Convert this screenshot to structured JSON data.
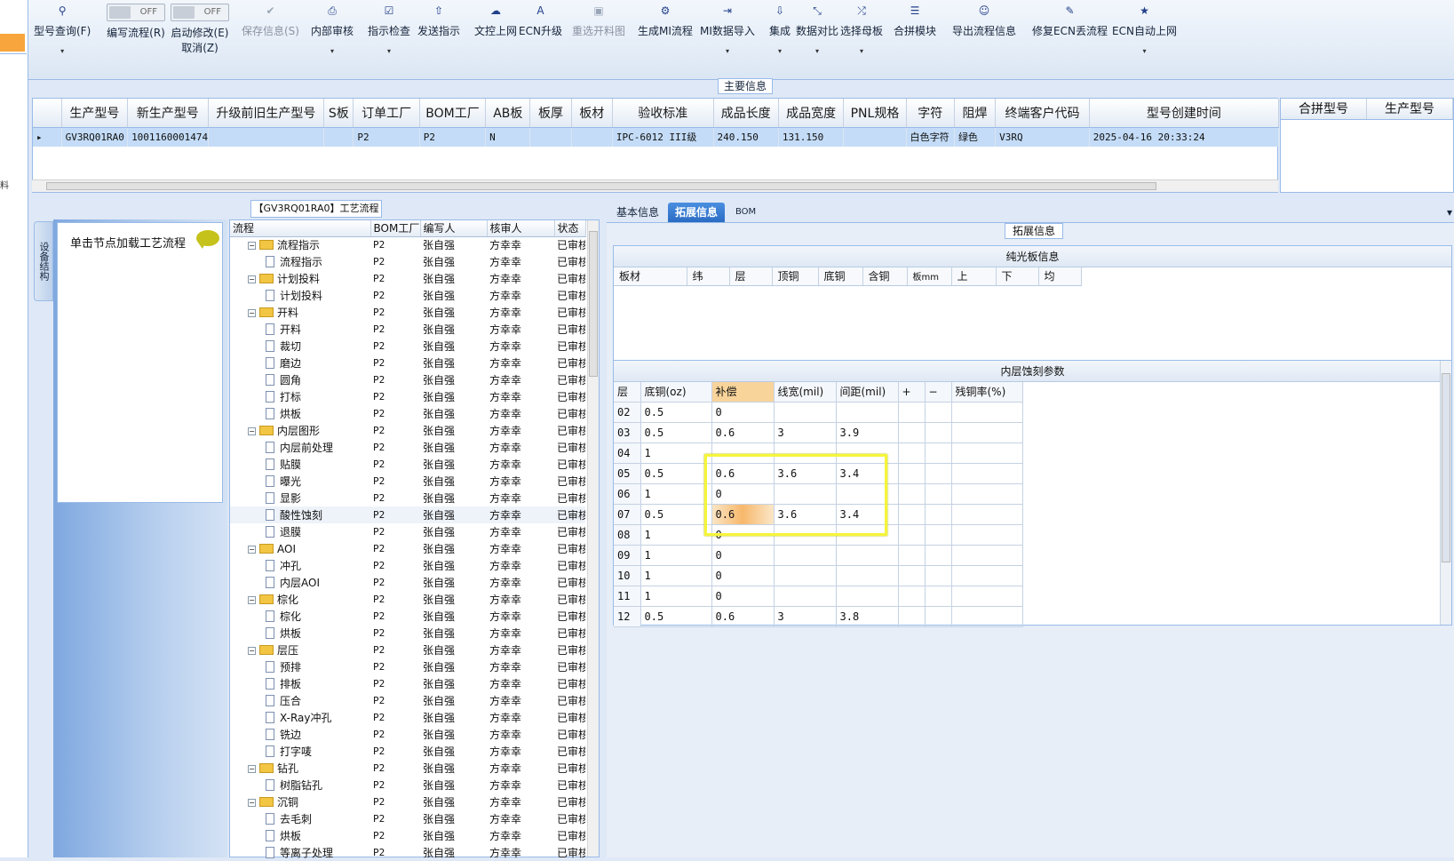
{
  "left_strip": {
    "label": "料"
  },
  "toolbar": {
    "items": [
      {
        "label": "型号查询(F)",
        "icon": "search-icon",
        "glyph": "⚲",
        "dropdown": true,
        "disabled": false
      },
      {
        "label": "编写流程(R)",
        "toggle": "OFF"
      },
      {
        "label": "启动修改(E)",
        "label2": "取消(Z)",
        "toggle": "OFF"
      },
      {
        "label": "保存信息(S)",
        "icon": "check-icon",
        "glyph": "✔",
        "disabled": true
      },
      {
        "label": "内部审核",
        "icon": "print-icon",
        "glyph": "⎙",
        "dropdown": true
      },
      {
        "label": "指示检查",
        "icon": "checkbox-icon",
        "glyph": "☑",
        "dropdown": true
      },
      {
        "label": "发送指示",
        "icon": "upload-icon",
        "glyph": "⇧"
      },
      {
        "label": "文控上网",
        "icon": "cloud-upload-icon",
        "glyph": "☁"
      },
      {
        "label": "ECN升级",
        "icon": "font-icon",
        "glyph": "A"
      },
      {
        "label": "重选开料图",
        "icon": "image-icon",
        "glyph": "▣",
        "disabled": true
      },
      {
        "label": "生成MI流程",
        "icon": "gears-icon",
        "glyph": "⚙"
      },
      {
        "label": "MI数据导入",
        "icon": "import-icon",
        "glyph": "⇥",
        "dropdown": true
      },
      {
        "label": "集成",
        "icon": "download-icon",
        "glyph": "⇩",
        "dropdown": true
      },
      {
        "label": "数据对比",
        "icon": "compress-icon",
        "glyph": "⤡",
        "dropdown": true
      },
      {
        "label": "选择母板",
        "icon": "shuffle-icon",
        "glyph": "⤮",
        "dropdown": true
      },
      {
        "label": "合拼模块",
        "icon": "list-icon",
        "glyph": "☰"
      },
      {
        "label": "导出流程信息",
        "icon": "smile-icon",
        "glyph": "☺"
      },
      {
        "label": "修复ECN丢流程",
        "icon": "wrench-icon",
        "glyph": "✎"
      },
      {
        "label": "ECN自动上网",
        "icon": "star-icon",
        "glyph": "★",
        "dropdown": true
      }
    ]
  },
  "main_info": {
    "title": "主要信息",
    "columns": [
      "生产型号",
      "新生产型号",
      "升级前旧生产型号",
      "S板",
      "订单工厂",
      "BOM工厂",
      "AB板",
      "板厚",
      "板材",
      "验收标准",
      "成品长度",
      "成品宽度",
      "PNL规格",
      "字符",
      "阻焊",
      "终端客户代码",
      "型号创建时间"
    ],
    "row": [
      "GV3RQ01RA0",
      "10011600014747",
      "",
      "",
      "P2",
      "P2",
      "N",
      "",
      "",
      "IPC-6012 III级",
      "240.150",
      "131.150",
      "",
      "白色字符",
      "绿色",
      "V3RQ",
      "2025-04-16 20:33:24"
    ],
    "side_columns": [
      "合拼型号",
      "生产型号"
    ]
  },
  "flow": {
    "title": "【GV3RQ01RA0】工艺流程",
    "side_tab": "设备结构",
    "load_hint": "单击节点加载工艺流程",
    "columns": [
      "流程",
      "BOM工厂",
      "编写人",
      "核审人",
      "状态"
    ],
    "rows": [
      {
        "name": "流程指示",
        "level": 0,
        "factory": "P2",
        "writer": "张自强",
        "reviewer": "方幸幸",
        "status": "已审核"
      },
      {
        "name": "流程指示",
        "level": 1,
        "factory": "P2",
        "writer": "张自强",
        "reviewer": "方幸幸",
        "status": "已审核"
      },
      {
        "name": "计划投料",
        "level": 0,
        "factory": "P2",
        "writer": "张自强",
        "reviewer": "方幸幸",
        "status": "已审核"
      },
      {
        "name": "计划投料",
        "level": 1,
        "factory": "P2",
        "writer": "张自强",
        "reviewer": "方幸幸",
        "status": "已审核"
      },
      {
        "name": "开料",
        "level": 0,
        "factory": "P2",
        "writer": "张自强",
        "reviewer": "方幸幸",
        "status": "已审核"
      },
      {
        "name": "开料",
        "level": 1,
        "factory": "P2",
        "writer": "张自强",
        "reviewer": "方幸幸",
        "status": "已审核"
      },
      {
        "name": "裁切",
        "level": 1,
        "factory": "P2",
        "writer": "张自强",
        "reviewer": "方幸幸",
        "status": "已审核"
      },
      {
        "name": "磨边",
        "level": 1,
        "factory": "P2",
        "writer": "张自强",
        "reviewer": "方幸幸",
        "status": "已审核"
      },
      {
        "name": "圆角",
        "level": 1,
        "factory": "P2",
        "writer": "张自强",
        "reviewer": "方幸幸",
        "status": "已审核"
      },
      {
        "name": "打标",
        "level": 1,
        "factory": "P2",
        "writer": "张自强",
        "reviewer": "方幸幸",
        "status": "已审核"
      },
      {
        "name": "烘板",
        "level": 1,
        "factory": "P2",
        "writer": "张自强",
        "reviewer": "方幸幸",
        "status": "已审核"
      },
      {
        "name": "内层图形",
        "level": 0,
        "factory": "P2",
        "writer": "张自强",
        "reviewer": "方幸幸",
        "status": "已审核"
      },
      {
        "name": "内层前处理",
        "level": 1,
        "factory": "P2",
        "writer": "张自强",
        "reviewer": "方幸幸",
        "status": "已审核"
      },
      {
        "name": "贴膜",
        "level": 1,
        "factory": "P2",
        "writer": "张自强",
        "reviewer": "方幸幸",
        "status": "已审核"
      },
      {
        "name": "曝光",
        "level": 1,
        "factory": "P2",
        "writer": "张自强",
        "reviewer": "方幸幸",
        "status": "已审核"
      },
      {
        "name": "显影",
        "level": 1,
        "factory": "P2",
        "writer": "张自强",
        "reviewer": "方幸幸",
        "status": "已审核"
      },
      {
        "name": "酸性蚀刻",
        "level": 1,
        "factory": "P2",
        "writer": "张自强",
        "reviewer": "方幸幸",
        "status": "已审核",
        "selected": true
      },
      {
        "name": "退膜",
        "level": 1,
        "factory": "P2",
        "writer": "张自强",
        "reviewer": "方幸幸",
        "status": "已审核"
      },
      {
        "name": "AOI",
        "level": 0,
        "factory": "P2",
        "writer": "张自强",
        "reviewer": "方幸幸",
        "status": "已审核"
      },
      {
        "name": "冲孔",
        "level": 1,
        "factory": "P2",
        "writer": "张自强",
        "reviewer": "方幸幸",
        "status": "已审核"
      },
      {
        "name": "内层AOI",
        "level": 1,
        "factory": "P2",
        "writer": "张自强",
        "reviewer": "方幸幸",
        "status": "已审核"
      },
      {
        "name": "棕化",
        "level": 0,
        "factory": "P2",
        "writer": "张自强",
        "reviewer": "方幸幸",
        "status": "已审核"
      },
      {
        "name": "棕化",
        "level": 1,
        "factory": "P2",
        "writer": "张自强",
        "reviewer": "方幸幸",
        "status": "已审核"
      },
      {
        "name": "烘板",
        "level": 1,
        "factory": "P2",
        "writer": "张自强",
        "reviewer": "方幸幸",
        "status": "已审核"
      },
      {
        "name": "层压",
        "level": 0,
        "factory": "P2",
        "writer": "张自强",
        "reviewer": "方幸幸",
        "status": "已审核"
      },
      {
        "name": "预排",
        "level": 1,
        "factory": "P2",
        "writer": "张自强",
        "reviewer": "方幸幸",
        "status": "已审核"
      },
      {
        "name": "排板",
        "level": 1,
        "factory": "P2",
        "writer": "张自强",
        "reviewer": "方幸幸",
        "status": "已审核"
      },
      {
        "name": "压合",
        "level": 1,
        "factory": "P2",
        "writer": "张自强",
        "reviewer": "方幸幸",
        "status": "已审核"
      },
      {
        "name": "X-Ray冲孔",
        "level": 1,
        "factory": "P2",
        "writer": "张自强",
        "reviewer": "方幸幸",
        "status": "已审核"
      },
      {
        "name": "铣边",
        "level": 1,
        "factory": "P2",
        "writer": "张自强",
        "reviewer": "方幸幸",
        "status": "已审核"
      },
      {
        "name": "打字唛",
        "level": 1,
        "factory": "P2",
        "writer": "张自强",
        "reviewer": "方幸幸",
        "status": "已审核"
      },
      {
        "name": "钻孔",
        "level": 0,
        "factory": "P2",
        "writer": "张自强",
        "reviewer": "方幸幸",
        "status": "已审核"
      },
      {
        "name": "树脂钻孔",
        "level": 1,
        "factory": "P2",
        "writer": "张自强",
        "reviewer": "方幸幸",
        "status": "已审核"
      },
      {
        "name": "沉铜",
        "level": 0,
        "factory": "P2",
        "writer": "张自强",
        "reviewer": "方幸幸",
        "status": "已审核"
      },
      {
        "name": "去毛刺",
        "level": 1,
        "factory": "P2",
        "writer": "张自强",
        "reviewer": "方幸幸",
        "status": "已审核"
      },
      {
        "name": "烘板",
        "level": 1,
        "factory": "P2",
        "writer": "张自强",
        "reviewer": "方幸幸",
        "status": "已审核"
      },
      {
        "name": "等离子处理",
        "level": 1,
        "factory": "P2",
        "writer": "张自强",
        "reviewer": "方幸幸",
        "status": "已审核"
      }
    ]
  },
  "right_tabs": {
    "items": [
      "基本信息",
      "拓展信息",
      "BOM"
    ],
    "active": 1
  },
  "ext": {
    "title": "拓展信息",
    "pure": {
      "title": "纯光板信息",
      "columns": [
        "板材",
        "纬",
        "层",
        "顶铜",
        "底铜",
        "含铜",
        "板mm",
        "上",
        "下",
        "均"
      ]
    },
    "inner": {
      "title": "内层蚀刻参数",
      "columns": [
        "层",
        "底铜(oz)",
        "补偿",
        "线宽(mil)",
        "间距(mil)",
        "+",
        "−",
        "残铜率(%)"
      ],
      "rows": [
        [
          "02",
          "0.5",
          "0",
          "",
          "",
          "",
          "",
          ""
        ],
        [
          "03",
          "0.5",
          "0.6",
          "3",
          "3.9",
          "",
          "",
          ""
        ],
        [
          "04",
          "1",
          "",
          "",
          "",
          "",
          "",
          ""
        ],
        [
          "05",
          "0.5",
          "0.6",
          "3.6",
          "3.4",
          "",
          "",
          ""
        ],
        [
          "06",
          "1",
          "0",
          "",
          "",
          "",
          "",
          ""
        ],
        [
          "07",
          "0.5",
          "0.6",
          "3.6",
          "3.4",
          "",
          "",
          ""
        ],
        [
          "08",
          "1",
          "0",
          "",
          "",
          "",
          "",
          ""
        ],
        [
          "09",
          "1",
          "0",
          "",
          "",
          "",
          "",
          ""
        ],
        [
          "10",
          "1",
          "0",
          "",
          "",
          "",
          "",
          ""
        ],
        [
          "11",
          "1",
          "0",
          "",
          "",
          "",
          "",
          ""
        ],
        [
          "12",
          "0.5",
          "0.6",
          "3",
          "3.8",
          "",
          "",
          ""
        ]
      ]
    }
  },
  "colors": {
    "accent": "#2b6cc4",
    "highlight": "#f5f53a",
    "selected_row": "#c4dcf7",
    "orange": "#f7b86c"
  }
}
